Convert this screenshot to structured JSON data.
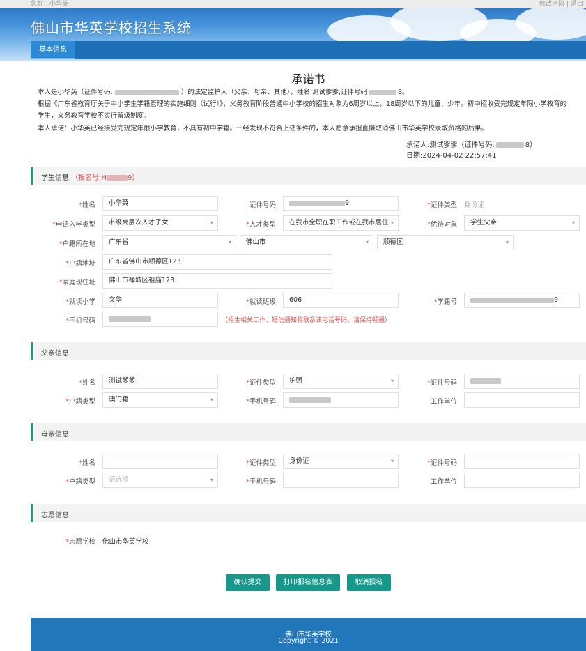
{
  "topbar": {
    "greeting": "您好，小华英",
    "change_password": "修改密码",
    "separator": "|",
    "logout": "退出"
  },
  "header": {
    "title": "佛山市华英学校招生系统",
    "tab": "基本信息"
  },
  "pledge": {
    "title": "承诺书",
    "p1_prefix": "本人是小华英（证件号码:",
    "p1_suffix": "）的法定监护人（父亲、母亲、其他），姓名 测试爹爹,证件号码",
    "p1_end": "8。",
    "p2": "根据《广东省教育厅关于中小学生学籍管理的实施细则（试行）》，义务教育阶段普通中小学校的招生对象为6周岁以上，18周岁以下的儿童、少年。初中招收受完规定年限小学教育的",
    "p3": "学生，义务教育学校不实行留级制度。",
    "p4": "本人承诺：小华英已经接受完规定年限小学教育，不具有初中学籍。一经发现不符合上述条件的，本人愿意承担直接取消佛山市华英学校录取资格的后果。",
    "signer_prefix": "承诺人:测试爹爹（证件号码:",
    "signer_suffix": "8）",
    "date": "日期:2024-04-02 22:57:41"
  },
  "student": {
    "section": "学生信息",
    "regno_prefix": "（报名号:H",
    "regno_suffix": "9）",
    "labels": {
      "name": "姓名",
      "id_no": "证件号码",
      "id_type": "证件类型",
      "apply_type": "申请入学类型",
      "talent_type": "人才类型",
      "priority": "优待对象",
      "hukou_loc": "户籍所在地",
      "hukou_addr": "户籍地址",
      "home_addr": "家庭现住址",
      "school": "就读小学",
      "class": "就读班级",
      "student_no": "学籍号",
      "phone": "手机号码"
    },
    "values": {
      "name": "小华英",
      "id_no_tail": "9",
      "id_type": "身份证",
      "apply_type": "市级高层次人才子女",
      "talent_type": "在我市全职在职工作或在我市居住",
      "priority": "学生父亲",
      "province": "广东省",
      "city": "佛山市",
      "district": "顺德区",
      "hukou_addr": "广东省佛山市顺德区123",
      "home_addr": "佛山市禅城区祖庙123",
      "school": "文华",
      "class": "606",
      "student_no_tail": "9"
    },
    "phone_warning": "（招生相关工作、短信通知将联系该电话号码，请保持畅通）"
  },
  "father": {
    "section": "父亲信息",
    "labels": {
      "name": "姓名",
      "id_type": "证件类型",
      "id_no": "证件号码",
      "hukou_type": "户籍类型",
      "phone": "手机号码",
      "work": "工作单位"
    },
    "values": {
      "name": "测试爹爹",
      "id_type": "护照",
      "hukou_type": "澳门籍",
      "work": ""
    }
  },
  "mother": {
    "section": "母亲信息",
    "labels": {
      "name": "姓名",
      "id_type": "证件类型",
      "id_no": "证件号码",
      "hukou_type": "户籍类型",
      "phone": "手机号码",
      "work": "工作单位"
    },
    "values": {
      "name": "",
      "id_type": "身份证",
      "id_no": "",
      "hukou_type": "请选择",
      "phone": "",
      "work": ""
    }
  },
  "wish": {
    "section": "志愿信息",
    "label": "志愿学校",
    "value": "佛山市华英学校"
  },
  "buttons": {
    "confirm": "确认提交",
    "print": "打印报名信息表",
    "cancel": "取消报名"
  },
  "footer": {
    "line1": "佛山市华英学校",
    "line2": "Copyright © 2021"
  },
  "colors": {
    "accent": "#17988a",
    "header_blue": "#2f7ac8",
    "footer_blue": "#2277bb",
    "required_red": "#d9534f"
  },
  "icons": {
    "select_arrow": "▾"
  }
}
